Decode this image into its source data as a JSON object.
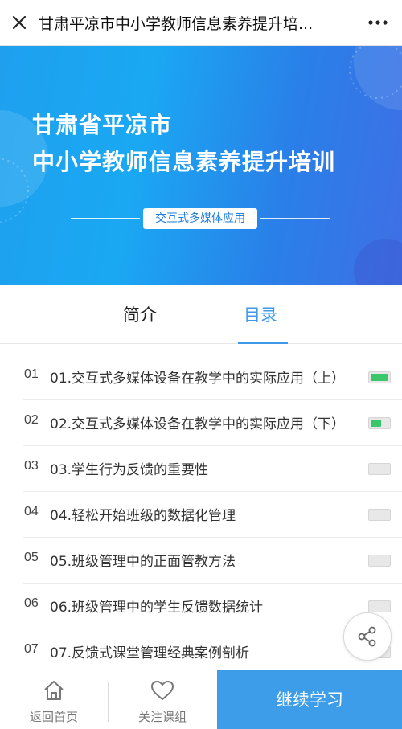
{
  "navbar": {
    "title": "甘肃平凉市中小学教师信息素养提升培...",
    "close_icon": "close-icon",
    "more_icon": "more-icon"
  },
  "banner": {
    "title_line1": "甘肃省平凉市",
    "title_line2": "中小学教师信息素养提升培训",
    "subtitle": "交互式多媒体应用"
  },
  "tabs": {
    "intro": "简介",
    "catalog": "目录",
    "active": "catalog"
  },
  "lessons": [
    {
      "num": "01",
      "title": "01.交互式多媒体设备在教学中的实际应用（上）",
      "progress": 1.0
    },
    {
      "num": "02",
      "title": "02.交互式多媒体设备在教学中的实际应用（下）",
      "progress": 0.6
    },
    {
      "num": "03",
      "title": "03.学生行为反馈的重要性",
      "progress": 0
    },
    {
      "num": "04",
      "title": "04.轻松开始班级的数据化管理",
      "progress": 0
    },
    {
      "num": "05",
      "title": "05.班级管理中的正面管教方法",
      "progress": 0
    },
    {
      "num": "06",
      "title": "06.班级管理中的学生反馈数据统计",
      "progress": 0
    },
    {
      "num": "07",
      "title": "07.反馈式课堂管理经典案例剖析",
      "progress": 0
    }
  ],
  "share_icon": "share-icon",
  "bottom_bar": {
    "home_label": "返回首页",
    "follow_label": "关注课组",
    "continue_label": "继续学习"
  },
  "colors": {
    "accent": "#3e9de9",
    "progress_fill": "#3ac66b",
    "banner_start": "#1ea0ef",
    "banner_end": "#3f6fe6"
  }
}
